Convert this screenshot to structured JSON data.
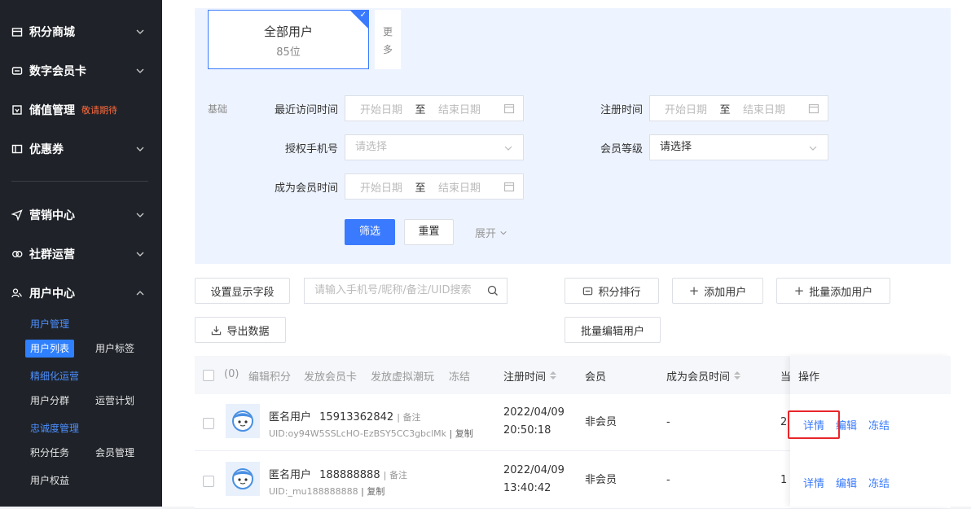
{
  "sidebar": {
    "menu": [
      {
        "label": "积分商城",
        "icon": "shop-icon"
      },
      {
        "label": "数字会员卡",
        "icon": "card-icon"
      },
      {
        "label": "储值管理",
        "icon": "wallet-icon",
        "tag": "敬请期待"
      },
      {
        "label": "优惠券",
        "icon": "coupon-icon"
      },
      {
        "label": "营销中心",
        "icon": "send-icon"
      },
      {
        "label": "社群运营",
        "icon": "community-icon"
      },
      {
        "label": "用户中心",
        "icon": "users-icon"
      }
    ],
    "groups": [
      "用户管理",
      "精细化运营",
      "忠诚度管理"
    ],
    "items": {
      "user_list": "用户列表",
      "user_tags": "用户标签",
      "user_segment": "用户分群",
      "operation_plan": "运营计划",
      "points_task": "积分任务",
      "member_mgmt": "会员管理",
      "user_rights": "用户权益"
    }
  },
  "filter": {
    "card_title": "全部用户",
    "card_count": "85位",
    "more": "更多",
    "base_label": "基础",
    "recent_visit_label": "最近访问时间",
    "register_time_label": "注册时间",
    "auth_phone_label": "授权手机号",
    "member_level_label": "会员等级",
    "become_member_label": "成为会员时间",
    "start_placeholder": "开始日期",
    "end_placeholder": "结束日期",
    "to": "至",
    "select_placeholder": "请选择",
    "member_level_value": "请选择",
    "filter_button": "筛选",
    "reset_button": "重置",
    "expand": "展开"
  },
  "toolbar": {
    "display_fields": "设置显示字段",
    "search_placeholder": "请输入手机号/昵称/备注/UID搜索",
    "points_rank": "积分排行",
    "add_user": "添加用户",
    "batch_add": "批量添加用户",
    "export": "导出数据",
    "batch_edit": "批量编辑用户"
  },
  "table": {
    "header": {
      "selected": "(0)",
      "edit_points": "编辑积分",
      "issue_card": "发放会员卡",
      "issue_virtual": "发放虚拟潮玩",
      "freeze": "冻结",
      "register_time": "注册时间",
      "member": "会员",
      "become_member_time": "成为会员时间",
      "partial": "当",
      "ops": "操作"
    },
    "rows": [
      {
        "name": "匿名用户",
        "phone": "15913362842",
        "note": "| 备注",
        "uid": "UID:oy94W5SSLcHO-EzBSY5CC3gbclMk",
        "copy": "| 复制",
        "date": "2022/04/09",
        "time": "20:50:18",
        "member": "非会员",
        "become": "-",
        "partial": "2"
      },
      {
        "name": "匿名用户",
        "phone": "188888888",
        "note": "| 备注",
        "uid": "UID:_mu188888888",
        "copy": "| 复制",
        "date": "2022/04/09",
        "time": "13:40:42",
        "member": "非会员",
        "become": "-",
        "partial": "1"
      }
    ],
    "ops": {
      "detail": "详情",
      "edit": "编辑",
      "freeze": "冻结"
    }
  }
}
